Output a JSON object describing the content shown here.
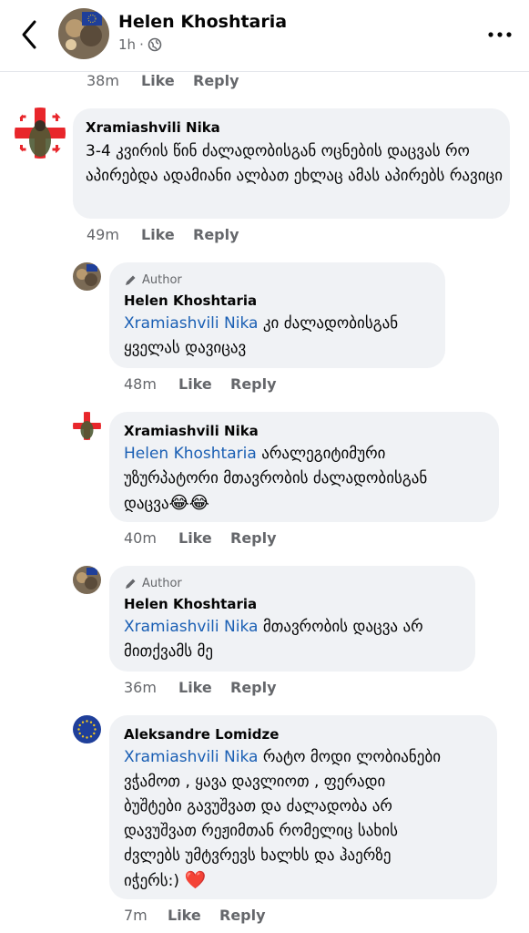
{
  "header": {
    "author_name": "Helen Khoshtaria",
    "time": "1h",
    "dot": "·",
    "icons": {
      "back": "chevron-left-icon",
      "privacy": "globe-icon",
      "more": "more-dots-icon"
    }
  },
  "actions": {
    "like": "Like",
    "reply": "Reply"
  },
  "prev_comment": {
    "time": "38m"
  },
  "comments": [
    {
      "name": "Xramiashvili Nika",
      "text": "3-4 კვირის წინ ძალადობისგან ოცნების დაცვას რო აპირებდა ადამიანი ალბათ ეხლაც ამას აპირებს რავიცი",
      "time": "49m"
    },
    {
      "badge": "Author",
      "name": "Helen Khoshtaria",
      "mention": "Xramiashvili Nika",
      "text_line1": "კი ძალადობისგან",
      "text_line2": "ყველას დავიცავ",
      "time": "48m"
    },
    {
      "name": "Xramiashvili Nika",
      "mention": "Helen Khoshtaria",
      "text_line1": "არალეგიტიმური",
      "text_line2": "უზურპატორი მთავრობის ძალადობისგან",
      "text_line3": "დაცვა",
      "emoji": "😂😂",
      "time": "40m"
    },
    {
      "badge": "Author",
      "name": "Helen Khoshtaria",
      "mention": "Xramiashvili Nika",
      "text_line1": "მთავრობის დაცვა არ",
      "text_line2": "მითქვამს მე",
      "time": "36m"
    },
    {
      "name": "Aleksandre Lomidze",
      "mention": "Xramiashvili Nika",
      "text_line1": "რატო მოდი ლობიანები",
      "text_line2": "ვჭამოთ , ყავა დავლიოთ , ფერადი",
      "text_line3": "ბუშტები გავუშვათ და ძალადობა არ",
      "text_line4": "დავუშვათ რეჟიმთან რომელიც სახის",
      "text_line5": "ძვლებს უმტვრევს ხალხს და ჰაერზე",
      "text_line6": "იჭერს:)",
      "emoji": "❤️",
      "time": "7m"
    }
  ],
  "colors": {
    "mention": "#1a5fb4",
    "bubble": "#f0f2f5",
    "meta": "#65676b"
  }
}
